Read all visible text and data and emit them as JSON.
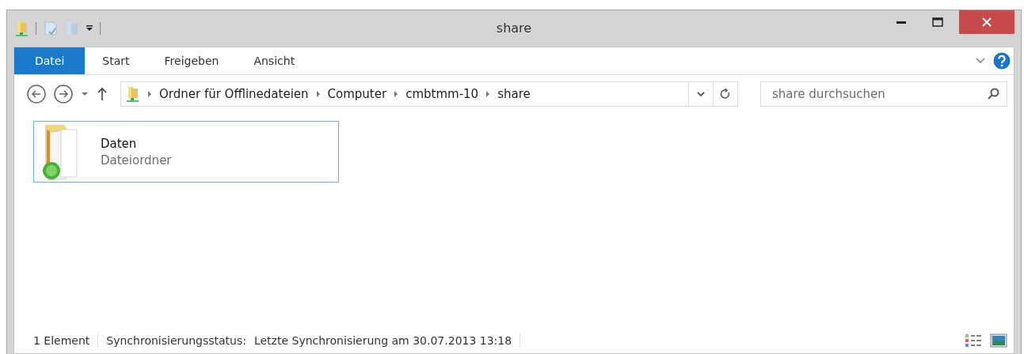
{
  "window": {
    "title": "share"
  },
  "ribbon_tabs": [
    {
      "label": "Datei",
      "selected": true
    },
    {
      "label": "Start",
      "selected": false
    },
    {
      "label": "Freigeben",
      "selected": false
    },
    {
      "label": "Ansicht",
      "selected": false
    }
  ],
  "address_bar": {
    "breadcrumbs": [
      "Ordner für Offlinedateien",
      "Computer",
      "cmbtmm-10",
      "share"
    ]
  },
  "search": {
    "placeholder": "share durchsuchen"
  },
  "items": [
    {
      "name": "Daten",
      "type": "Dateiordner",
      "selected": true
    }
  ],
  "status_bar": {
    "count": "1 Element",
    "sync_label": "Synchronisierungsstatus:",
    "sync_value": "Letzte Synchronisierung am 30.07.2013 13:18"
  }
}
